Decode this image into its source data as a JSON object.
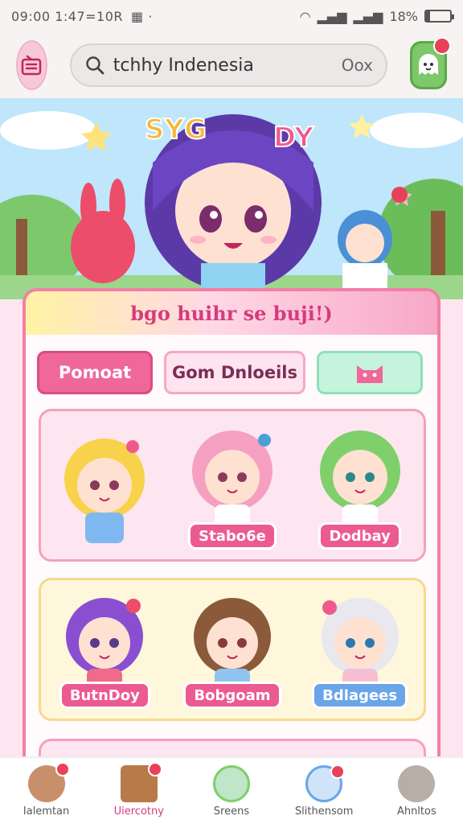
{
  "status": {
    "time": "09:00 1:47=10R",
    "battery": "18%",
    "battery_level": 0.18
  },
  "search": {
    "value": "tchhy Indenesia",
    "end": "Oox"
  },
  "banner": {
    "title_left": "SYG",
    "title_right": "DY"
  },
  "card": {
    "heading": "bgo huihr se buji!)",
    "tabs": [
      "Pomoat",
      "Gom Dnloeils"
    ]
  },
  "characters": [
    {
      "label": "",
      "hair": "#f9d24c",
      "bg": "#fde6f0"
    },
    {
      "label": "Stabo6e",
      "hair": "#f6a0c1"
    },
    {
      "label": "Dodbay",
      "hair": "#7fcf6a"
    },
    {
      "label": "ButnDoy",
      "hair": "#8a4fd0"
    },
    {
      "label": "Bobgoam",
      "hair": "#8a5a3a"
    },
    {
      "label": "Bdlagees",
      "hair": "#f2f2f5"
    }
  ],
  "bottom_nav": [
    {
      "label": "Ialemtan",
      "icon": "bear-icon"
    },
    {
      "label": "Uiercotny",
      "icon": "notebook-icon"
    },
    {
      "label": "Sreens",
      "icon": "ball-icon"
    },
    {
      "label": "Slithensom",
      "icon": "wand-icon"
    },
    {
      "label": "Ahnltos",
      "icon": "cat-icon"
    }
  ],
  "colors": {
    "accent": "#f0679a",
    "label_pink": "#ec5a92",
    "label_blue": "#6aa5e8"
  }
}
